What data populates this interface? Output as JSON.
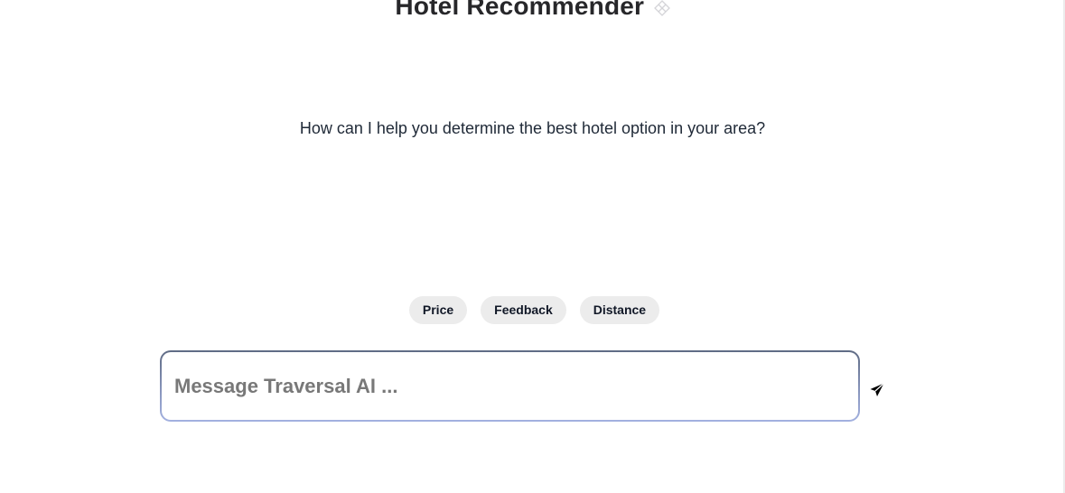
{
  "header": {
    "title": "Hotel Recommender",
    "title_icon": "diamond-grid-icon"
  },
  "main": {
    "prompt": "How can I help you determine the best hotel option in your area?"
  },
  "suggestions": [
    {
      "label": "Price"
    },
    {
      "label": "Feedback"
    },
    {
      "label": "Distance"
    }
  ],
  "composer": {
    "value": "",
    "placeholder": "Message Traversal AI ...",
    "send_icon": "paper-plane-icon"
  },
  "colors": {
    "chip_bg": "#ececec",
    "input_border_top": "#5f6b84",
    "input_border_bottom": "#a3b1e0",
    "placeholder": "#787878"
  }
}
